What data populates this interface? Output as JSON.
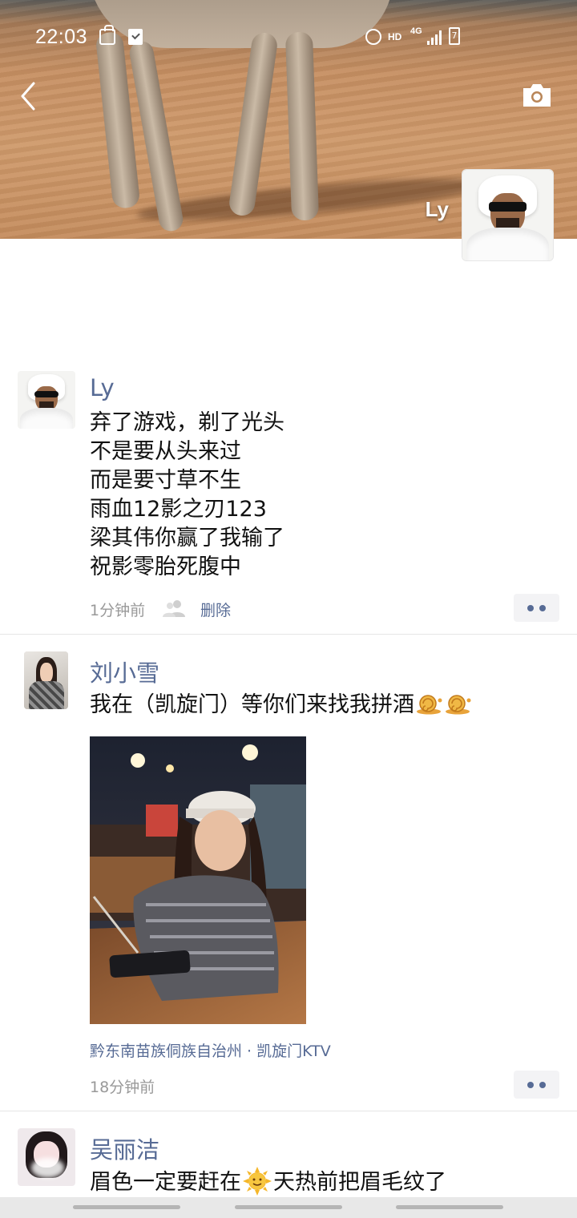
{
  "status_bar": {
    "time": "22:03",
    "hd_label": "HD",
    "network_label": "4G",
    "battery_label": "7"
  },
  "header": {
    "owner_name": "Ly",
    "back_icon": "chevron-left-icon",
    "camera_icon": "camera-icon"
  },
  "posts": [
    {
      "name": "Ly",
      "lines": [
        "弃了游戏，剃了光头",
        "不是要从头来过",
        "而是要寸草不生",
        "雨血12影之刃123",
        "梁其伟你赢了我输了",
        "祝影零胎死腹中"
      ],
      "time": "1分钟前",
      "delete_label": "删除"
    },
    {
      "name": "刘小雪",
      "text": "我在（凯旋门）等你们来找我拼酒",
      "location": "黔东南苗族侗族自治州 · 凯旋门KTV",
      "time": "18分钟前"
    },
    {
      "name": "吴丽洁",
      "text_before": "眉色一定要赶在",
      "text_after": "天热前把眉毛纹了"
    }
  ],
  "colors": {
    "name_link": "#576b95",
    "meta_gray": "#999999"
  }
}
